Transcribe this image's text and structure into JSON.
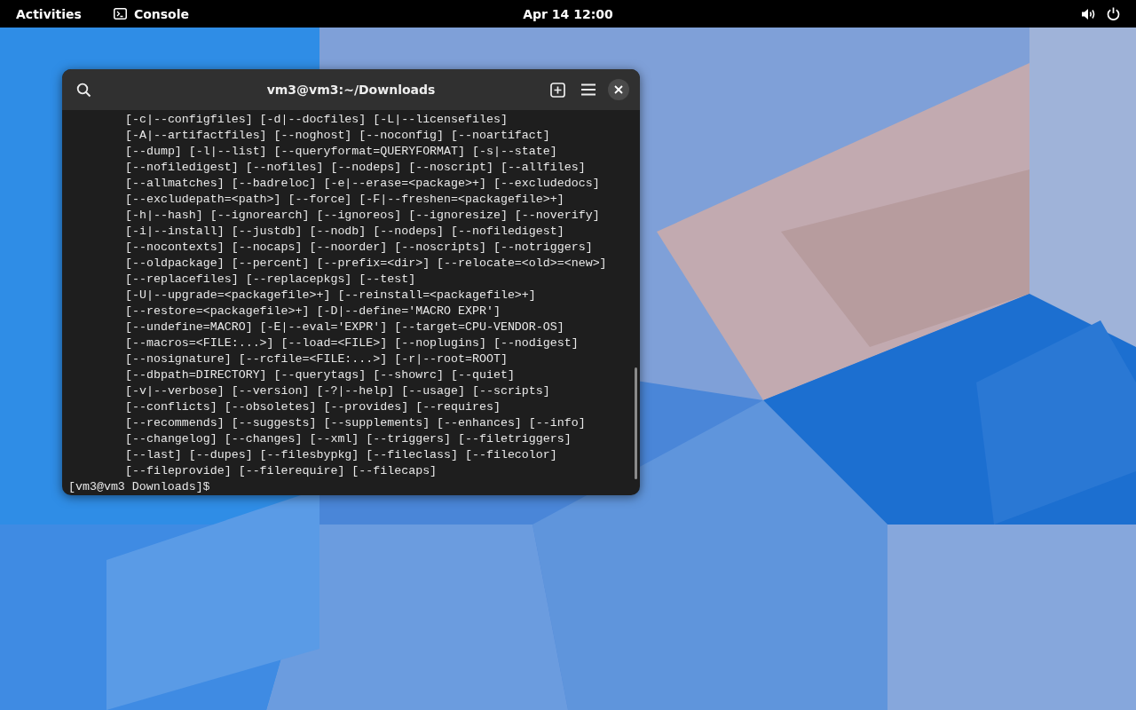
{
  "top_bar": {
    "activities": "Activities",
    "app_name": "Console",
    "clock": "Apr 14  12:00"
  },
  "window": {
    "title": "vm3@vm3:~/Downloads",
    "output_lines": [
      "[-c|--configfiles] [-d|--docfiles] [-L|--licensefiles]",
      "[-A|--artifactfiles] [--noghost] [--noconfig] [--noartifact]",
      "[--dump] [-l|--list] [--queryformat=QUERYFORMAT] [-s|--state]",
      "[--nofiledigest] [--nofiles] [--nodeps] [--noscript] [--allfiles]",
      "[--allmatches] [--badreloc] [-e|--erase=<package>+] [--excludedocs]",
      "[--excludepath=<path>] [--force] [-F|--freshen=<packagefile>+]",
      "[-h|--hash] [--ignorearch] [--ignoreos] [--ignoresize] [--noverify]",
      "[-i|--install] [--justdb] [--nodb] [--nodeps] [--nofiledigest]",
      "[--nocontexts] [--nocaps] [--noorder] [--noscripts] [--notriggers]",
      "[--oldpackage] [--percent] [--prefix=<dir>] [--relocate=<old>=<new>]",
      "[--replacefiles] [--replacepkgs] [--test]",
      "[-U|--upgrade=<packagefile>+] [--reinstall=<packagefile>+]",
      "[--restore=<packagefile>+] [-D|--define='MACRO EXPR']",
      "[--undefine=MACRO] [-E|--eval='EXPR'] [--target=CPU-VENDOR-OS]",
      "[--macros=<FILE:...>] [--load=<FILE>] [--noplugins] [--nodigest]",
      "[--nosignature] [--rcfile=<FILE:...>] [-r|--root=ROOT]",
      "[--dbpath=DIRECTORY] [--querytags] [--showrc] [--quiet]",
      "[-v|--verbose] [--version] [-?|--help] [--usage] [--scripts]",
      "[--conflicts] [--obsoletes] [--provides] [--requires]",
      "[--recommends] [--suggests] [--supplements] [--enhances] [--info]",
      "[--changelog] [--changes] [--xml] [--triggers] [--filetriggers]",
      "[--last] [--dupes] [--filesbypkg] [--fileclass] [--filecolor]",
      "[--fileprovide] [--filerequire] [--filecaps]"
    ],
    "prompt": "[vm3@vm3 Downloads]$"
  }
}
